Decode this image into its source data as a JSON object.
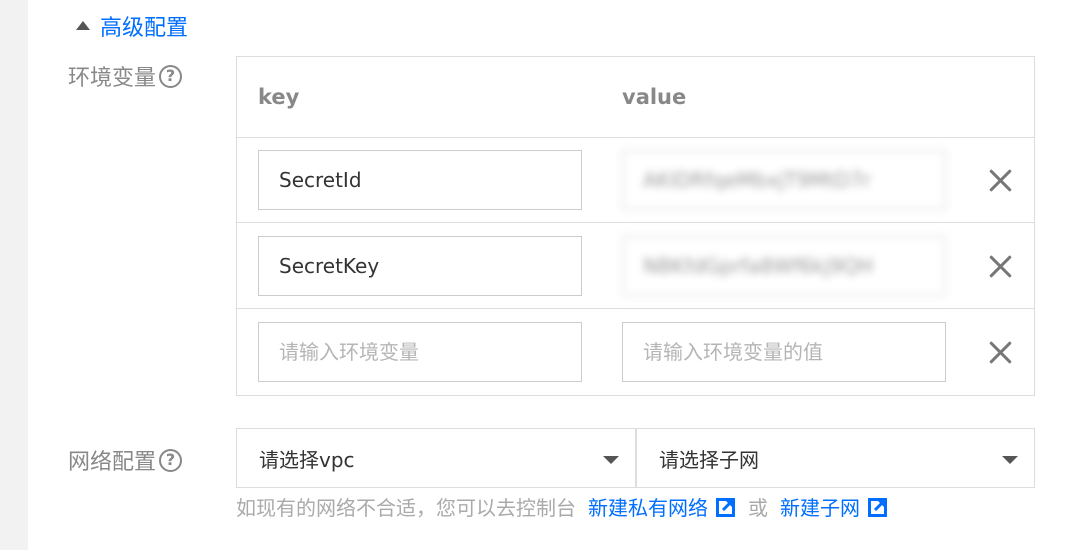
{
  "advanced": {
    "toggle_label": "高级配置"
  },
  "env": {
    "label": "环境变量",
    "help_glyph": "?",
    "columns": {
      "key": "key",
      "value": "value"
    },
    "rows": [
      {
        "key": "SecretId",
        "value": "AKIDRfqeMbxjT9MtD7r"
      },
      {
        "key": "SecretKey",
        "value": "NBKfdGprfa8Wf6kj9QH"
      }
    ],
    "new_row": {
      "key_placeholder": "请输入环境变量",
      "value_placeholder": "请输入环境变量的值"
    }
  },
  "network": {
    "label": "网络配置",
    "help_glyph": "?",
    "vpc_select": "请选择vpc",
    "subnet_select": "请选择子网",
    "hint": "如现有的网络不合适，您可以去控制台",
    "link_vpc": "新建私有网络",
    "or_text": "或",
    "link_subnet": "新建子网"
  },
  "colors": {
    "accent": "#006eff",
    "label": "#888888",
    "border": "#dddddd"
  }
}
